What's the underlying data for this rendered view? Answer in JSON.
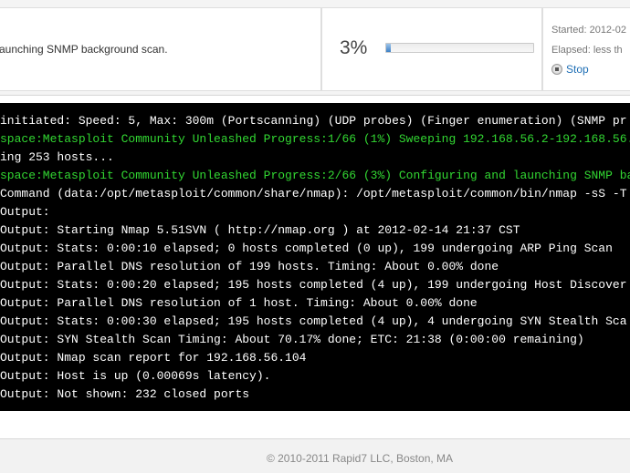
{
  "status": {
    "message": "aunching SNMP background scan.",
    "progress_percent": "3%",
    "progress_fraction": 0.03,
    "started": "Started: 2012-02",
    "elapsed": "Elapsed: less th",
    "stop_label": "Stop"
  },
  "colors": {
    "console_bg": "#000000",
    "console_text": "#ffffff",
    "console_highlight": "#32d732",
    "link": "#1f6fb5",
    "progress": "#3d80c6"
  },
  "console": {
    "lines": [
      {
        "text": "initiated: Speed: 5, Max: 300m (Portscanning) (UDP probes) (Finger enumeration) (SNMP pr",
        "style": "white"
      },
      {
        "text": "space:Metasploit Community Unleashed Progress:1/66 (1%) Sweeping 192.168.56.2-192.168.56.",
        "style": "green"
      },
      {
        "text": "ing 253 hosts...",
        "style": "white"
      },
      {
        "text": "space:Metasploit Community Unleashed Progress:2/66 (3%) Configuring and launching SNMP ba",
        "style": "green"
      },
      {
        "text": "Command (data:/opt/metasploit/common/share/nmap): /opt/metasploit/common/bin/nmap -sS -T",
        "style": "white"
      },
      {
        "text": "Output:",
        "style": "white"
      },
      {
        "text": "Output: Starting Nmap 5.51SVN ( http://nmap.org ) at 2012-02-14 21:37 CST",
        "style": "white"
      },
      {
        "text": "Output: Stats: 0:00:10 elapsed; 0 hosts completed (0 up), 199 undergoing ARP Ping Scan",
        "style": "white"
      },
      {
        "text": "Output: Parallel DNS resolution of 199 hosts. Timing: About 0.00% done",
        "style": "white"
      },
      {
        "text": "Output: Stats: 0:00:20 elapsed; 195 hosts completed (4 up), 199 undergoing Host Discover",
        "style": "white"
      },
      {
        "text": "Output: Parallel DNS resolution of 1 host. Timing: About 0.00% done",
        "style": "white"
      },
      {
        "text": "Output: Stats: 0:00:30 elapsed; 195 hosts completed (4 up), 4 undergoing SYN Stealth Sca",
        "style": "white"
      },
      {
        "text": "Output: SYN Stealth Scan Timing: About 70.17% done; ETC: 21:38 (0:00:00 remaining)",
        "style": "white"
      },
      {
        "text": "Output: Nmap scan report for 192.168.56.104",
        "style": "white"
      },
      {
        "text": "Output: Host is up (0.00069s latency).",
        "style": "white"
      },
      {
        "text": "Output: Not shown: 232 closed ports",
        "style": "white"
      }
    ]
  },
  "footer": {
    "copyright": "© 2010-2011 Rapid7 LLC, Boston, MA"
  }
}
